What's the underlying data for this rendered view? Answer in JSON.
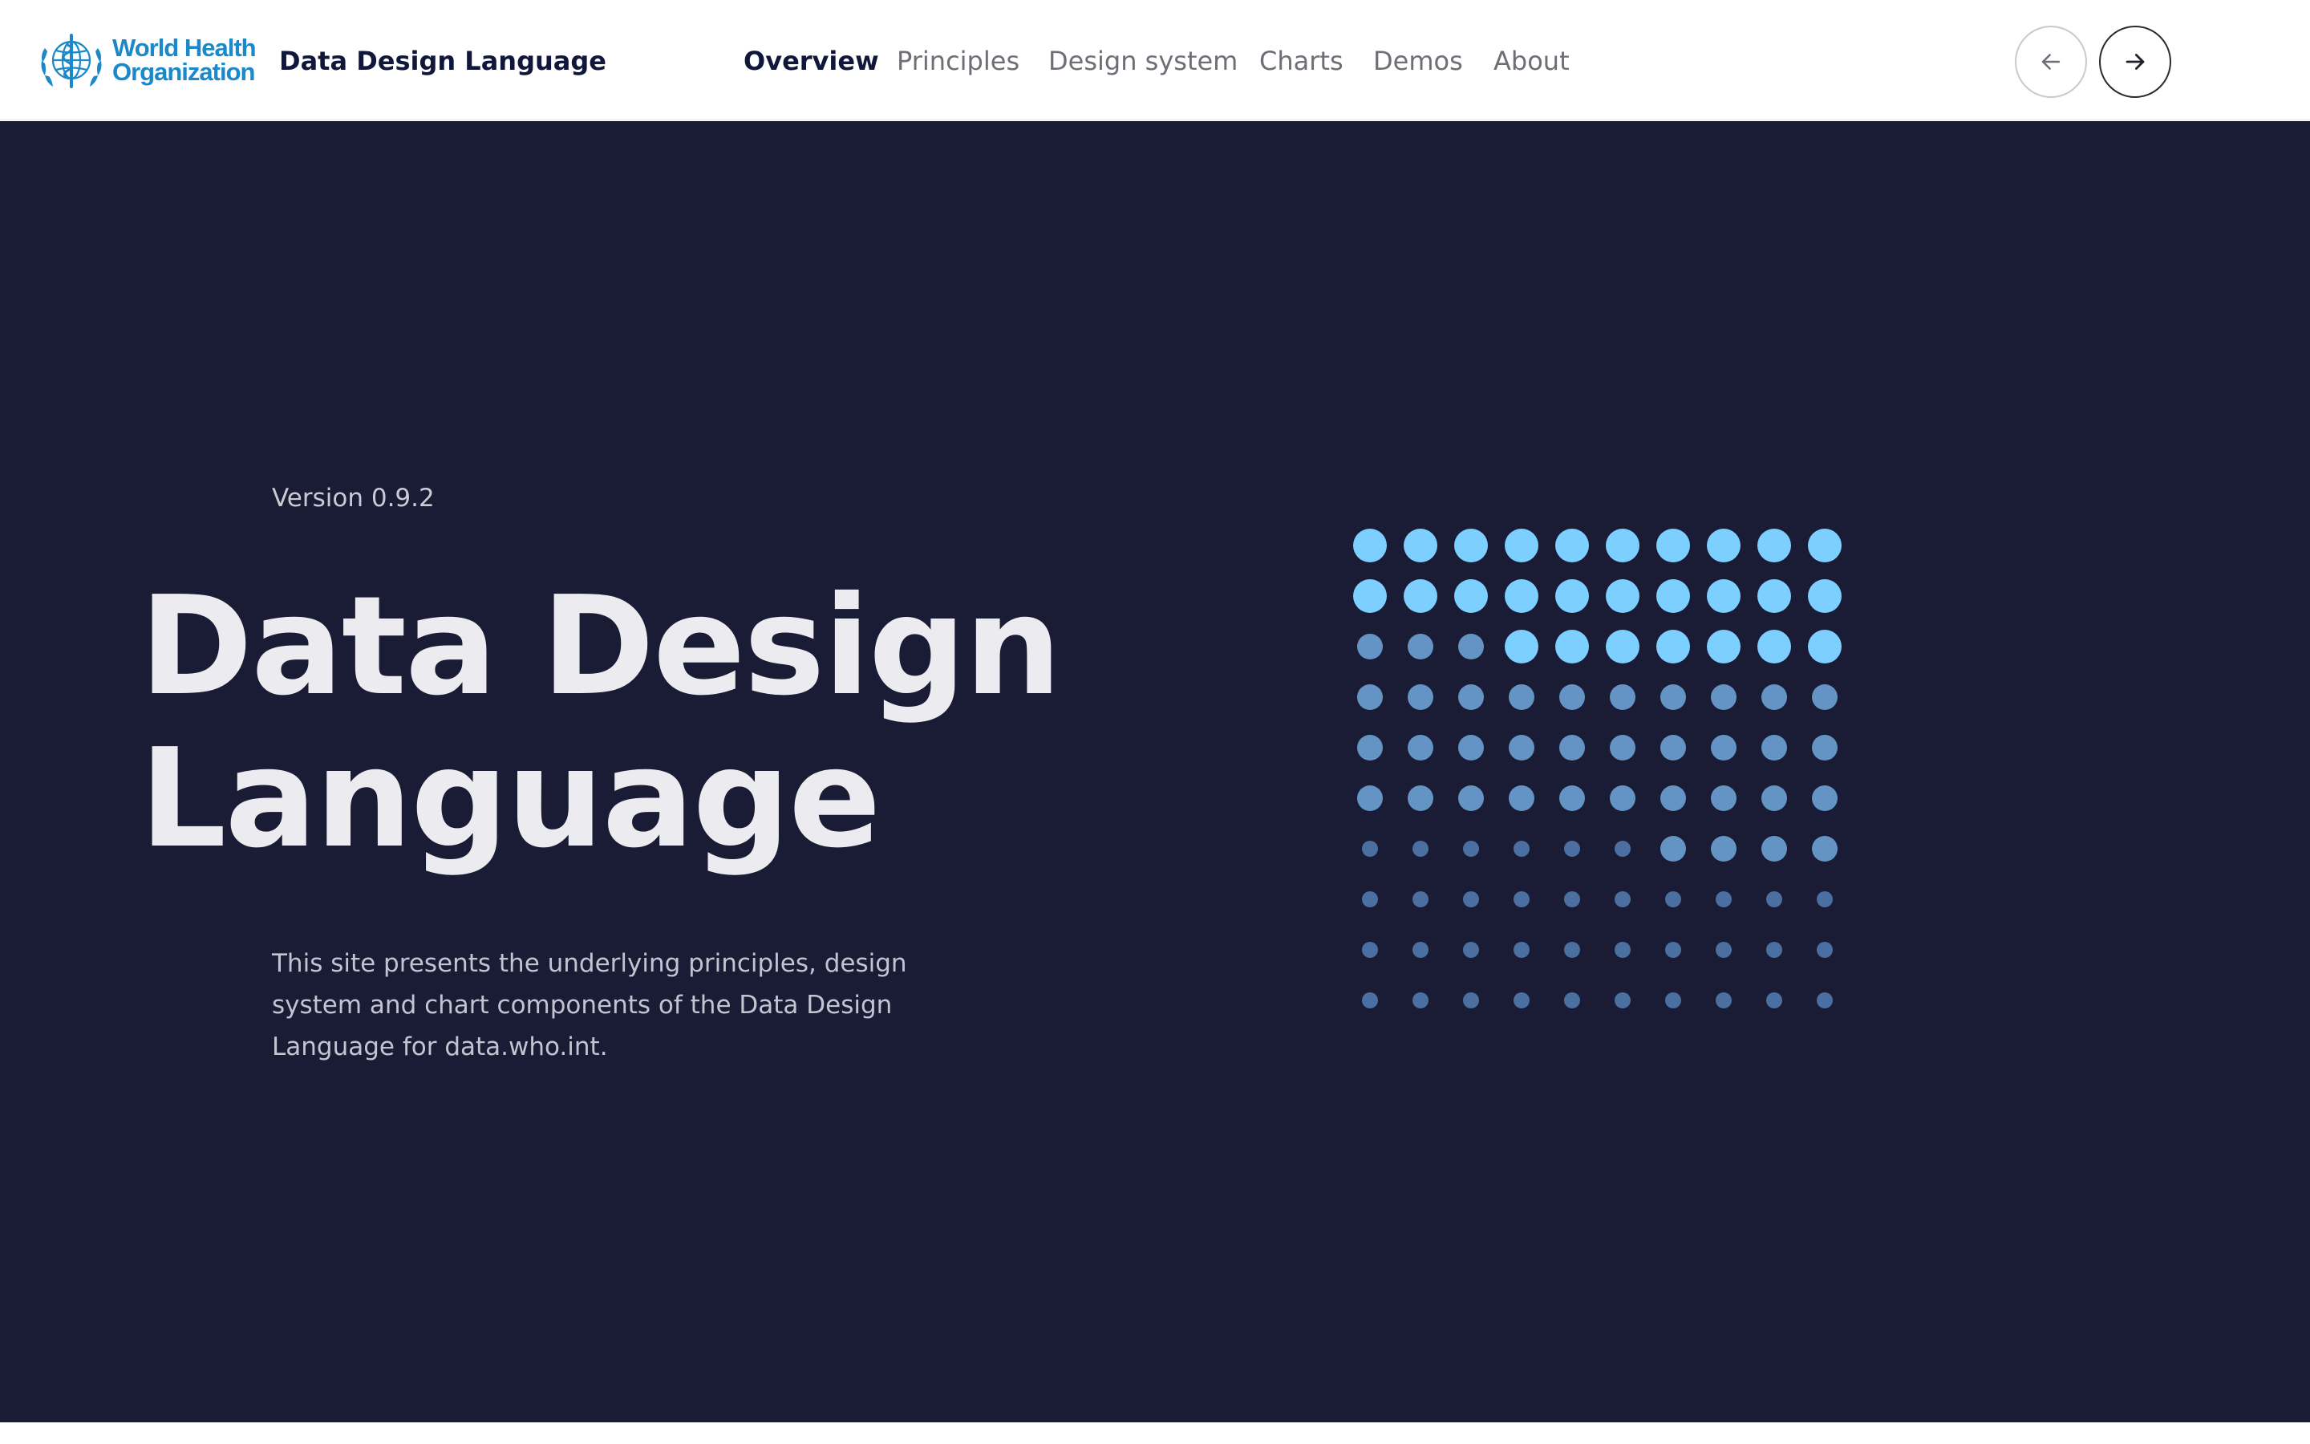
{
  "header": {
    "logo": {
      "line1": "World Health",
      "line2": "Organization",
      "icon": "who-emblem-icon"
    },
    "site_title": "Data Design Language",
    "nav": [
      {
        "label": "Overview",
        "active": true
      },
      {
        "label": "Principles",
        "active": false
      },
      {
        "label": "Design system",
        "active": false
      },
      {
        "label": "Charts",
        "active": false
      },
      {
        "label": "Demos",
        "active": false
      },
      {
        "label": "About",
        "active": false
      }
    ],
    "prev_icon": "arrow-left-icon",
    "next_icon": "arrow-right-icon"
  },
  "hero": {
    "version": "Version 0.9.2",
    "title_line1": "Data Design",
    "title_line2": "Language",
    "description": "This site presents the underlying principles, design system and chart components of the Data Design Language for data.who.int.",
    "dot_grid": {
      "rows": 10,
      "cols": 10,
      "legend_levels": [
        "bright-large",
        "muted-medium",
        "dim-small"
      ],
      "grid": [
        "LLLLLLLLLL",
        "LLLLLLLLLL",
        "MMMLLLLLLL",
        "MMMMMMMMMM",
        "MMMMMMMMMM",
        "MMMMMMMMMM",
        "SSSSSSMMMM",
        "SSSSSSSSSS",
        "SSSSSSSSSS",
        "SSSSSSSSSS"
      ]
    }
  },
  "colors": {
    "hero_background": "#1a1b34",
    "logo_blue": "#1a88c9",
    "dot_bright": "#7dcfff",
    "dot_muted": "#6494c4",
    "dot_dim": "#4a6fa0",
    "nav_active": "#10173a",
    "nav_inactive": "#6e6e76"
  }
}
